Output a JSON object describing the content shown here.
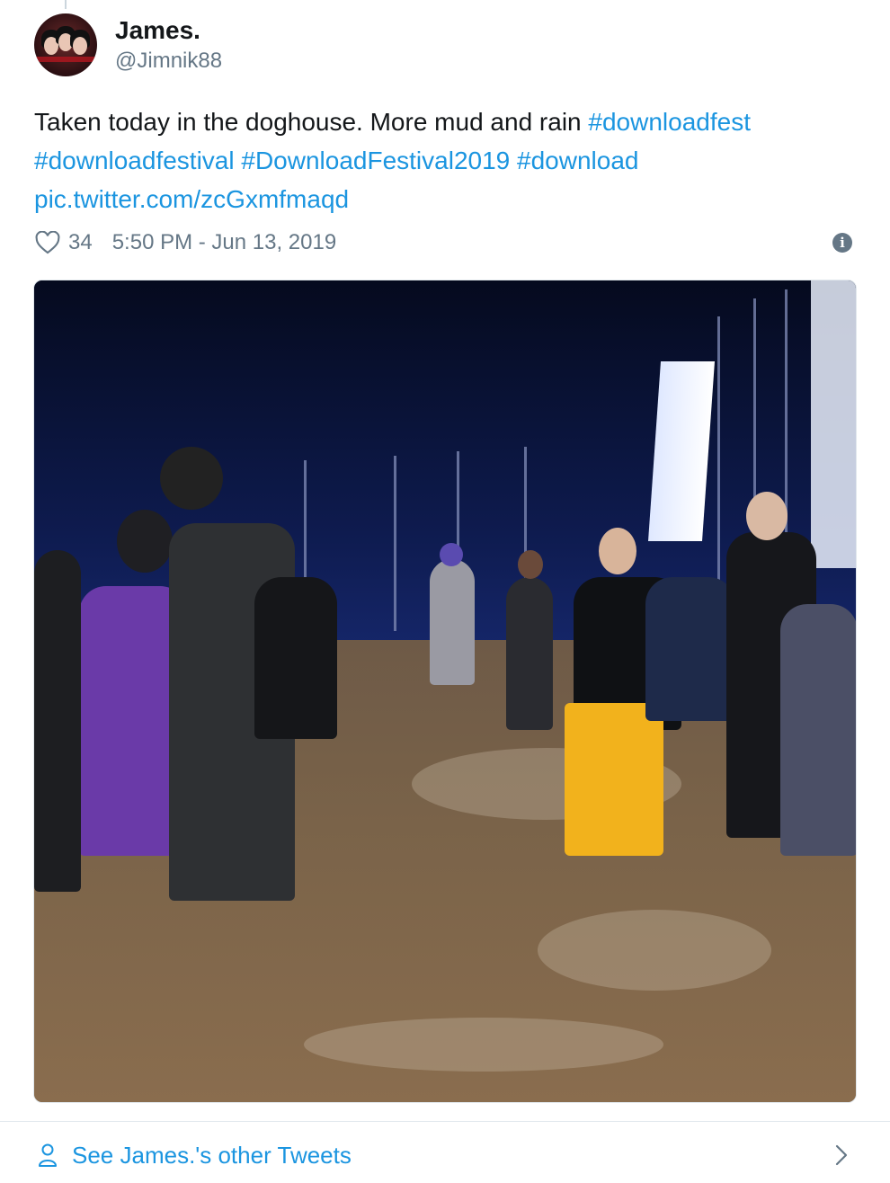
{
  "author": {
    "display_name": "James.",
    "handle": "@Jimnik88"
  },
  "tweet": {
    "text_plain": "Taken today in the doghouse. More mud and rain ",
    "hashtags": [
      "#downloadfest",
      "#downloadfestival",
      "#DownloadFestival2019",
      "#download"
    ],
    "link": "pic.twitter.com/zcGxmfmaqd"
  },
  "meta": {
    "likes": "34",
    "timestamp": "5:50 PM - Jun 13, 2019"
  },
  "footer": {
    "see_more": "See James.'s other Tweets"
  },
  "icons": {
    "like": "heart-icon",
    "info": "info-icon",
    "profile": "user-icon",
    "chevron": "chevron-right-icon"
  },
  "colors": {
    "link": "#1b95e0",
    "secondary_text": "#657786",
    "divider": "#e1e8ed"
  }
}
